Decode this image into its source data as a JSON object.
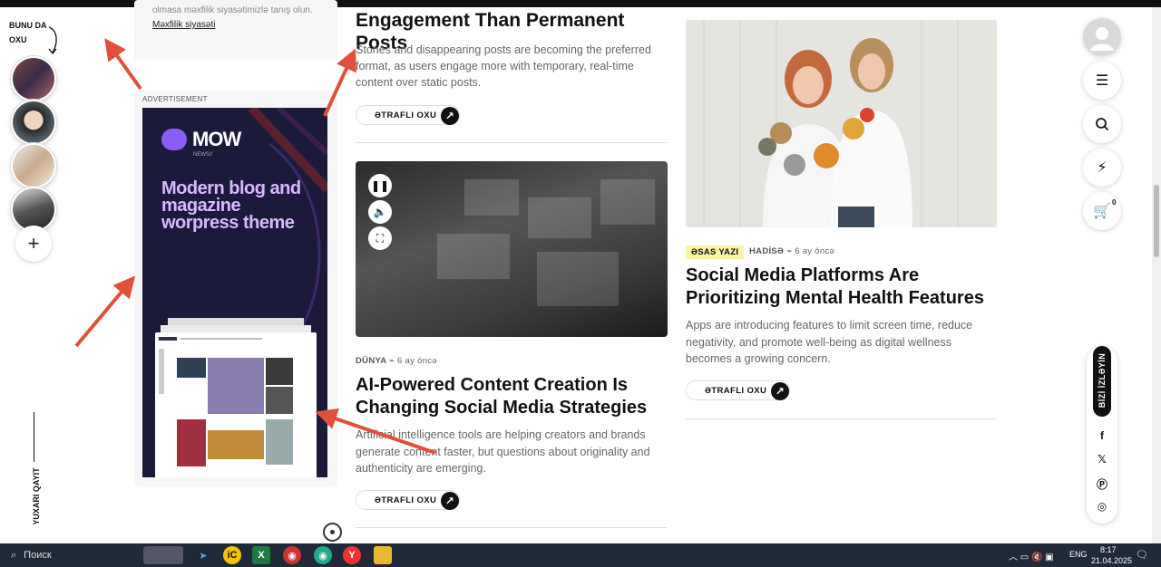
{
  "stories": {
    "title": "BUNU DA OXU",
    "add_label": "+"
  },
  "back_to_top": "YUXARI QAYIT",
  "prev_card": {
    "text": "olmasa məxfilik siyasətimizlə tanış olun.",
    "link": "Məxfilik siyasəti"
  },
  "ad": {
    "label": "ADVERTISEMENT",
    "brand": "MOW",
    "brand_sub": "NEWS//",
    "headline": "Modern blog and magazine worpress theme"
  },
  "articles": {
    "top": {
      "title": "Engagement Than Permanent Posts",
      "excerpt": "Stories and disappearing posts are becoming the preferred format, as users engage more with temporary, real-time content over static posts.",
      "more": "ƏTRAFLI OXU"
    },
    "ai": {
      "category": "DÜNYA",
      "time": "6 ay öncə",
      "title": "AI-Powered Content Creation Is Changing Social Media Strategies",
      "excerpt": "Artificial intelligence tools are helping creators and brands generate content faster, but questions about originality and authenticity are emerging.",
      "more": "ƏTRAFLI OXU"
    },
    "mental": {
      "badge": "ƏSAS YAZI",
      "category": "HADİSƏ",
      "time": "6 ay öncə",
      "title": "Social Media Platforms Are Prioritizing Mental Health Features",
      "excerpt": "Apps are introducing features to limit screen time, reduce negativity, and promote well-being as digital wellness becomes a growing concern.",
      "more": "ƏTRAFLI OXU"
    }
  },
  "sidebar": {
    "cart_count": "0",
    "follow_label": "BİZİ İZLƏYİN",
    "socials": [
      "facebook-icon",
      "x-icon",
      "pinterest-icon",
      "instagram-icon"
    ]
  },
  "taskbar": {
    "search": "Поиск",
    "lang": "ENG",
    "time": "8:17",
    "date": "21.04.2025"
  },
  "colors": {
    "badge": "#fbf3a8",
    "ad_bg": "#1c1a3a",
    "ad_text": "#d9b8ff",
    "arrow": "#e0503a"
  }
}
